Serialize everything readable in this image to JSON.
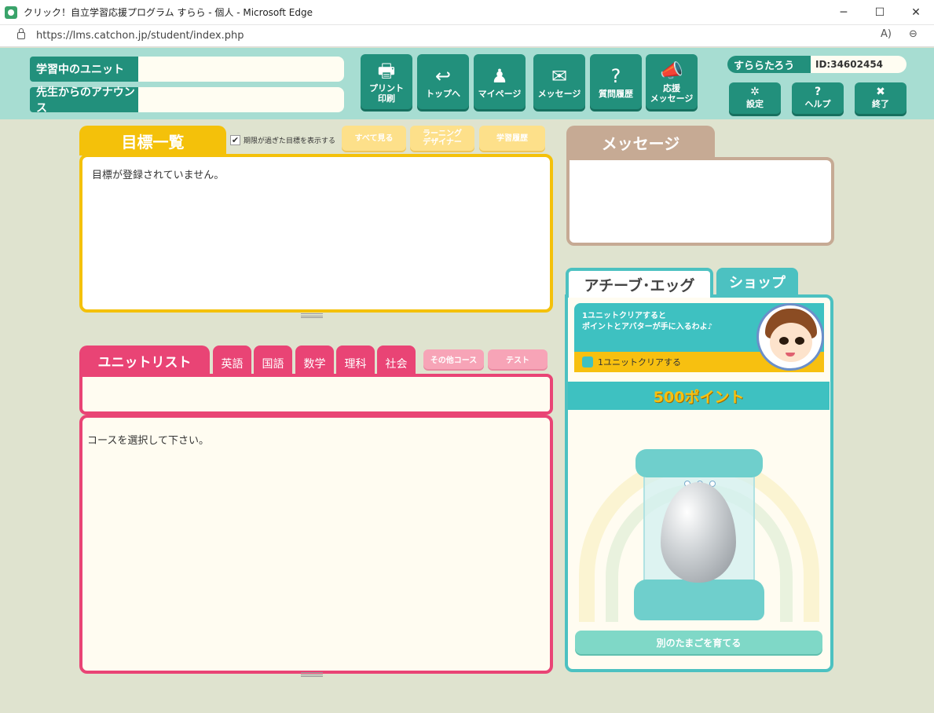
{
  "window": {
    "title": "クリック！自立学習応援プログラム すらら - 個人 - Microsoft Edge",
    "url": "https://lms.catchon.jp/student/index.php",
    "minimize": "─",
    "maximize": "☐",
    "close": "✕",
    "read_aloud": "A)",
    "zoom": "⊖"
  },
  "header": {
    "current_unit_label": "学習中のユニット",
    "announce_label": "先生からのアナウンス",
    "nav": [
      {
        "label": "プリント\n印刷",
        "icon": "printer-icon",
        "glyph": "🖶"
      },
      {
        "label": "トップへ",
        "icon": "return-icon",
        "glyph": "↩"
      },
      {
        "label": "マイページ",
        "icon": "person-icon",
        "glyph": "♟"
      },
      {
        "label": "メッセージ",
        "icon": "mail-icon",
        "glyph": "✉"
      },
      {
        "label": "質問履歴",
        "icon": "question-icon",
        "glyph": "?"
      },
      {
        "label": "応援\nメッセージ",
        "icon": "megaphone-icon",
        "glyph": "📣"
      }
    ],
    "user_name": "すららたろう",
    "user_id": "ID:34602454",
    "system": [
      {
        "label": "設定",
        "icon": "gear-icon",
        "glyph": "✲"
      },
      {
        "label": "ヘルプ",
        "icon": "help-icon",
        "glyph": "?"
      },
      {
        "label": "終了",
        "icon": "exit-icon",
        "glyph": "✖"
      }
    ]
  },
  "goals": {
    "tab_label": "目標一覧",
    "show_expired_label": "期限が過ぎた目標を表示する",
    "check_mark": "✔",
    "buttons": [
      "すべて見る",
      "ラーニング\nデザイナー",
      "学習履歴"
    ],
    "empty_text": "目標が登録されていません。"
  },
  "units": {
    "tab_label": "ユニットリスト",
    "subjects": [
      "英語",
      "国語",
      "数学",
      "理科",
      "社会"
    ],
    "other_course_label": "その他コース",
    "test_label": "テスト",
    "empty_text": "コースを選択して下さい。"
  },
  "message": {
    "tab_label": "メッセージ"
  },
  "egg": {
    "achieve_tab": "アチーブ･エッグ",
    "shop_tab": "ショップ",
    "mission_text": "1ユニットクリアすると\nポイントとアバターが手に入るわよ♪",
    "mission_task": "1ユニットクリアする",
    "points": "500ポイント",
    "raise_button": "別のたまごを育てる"
  }
}
